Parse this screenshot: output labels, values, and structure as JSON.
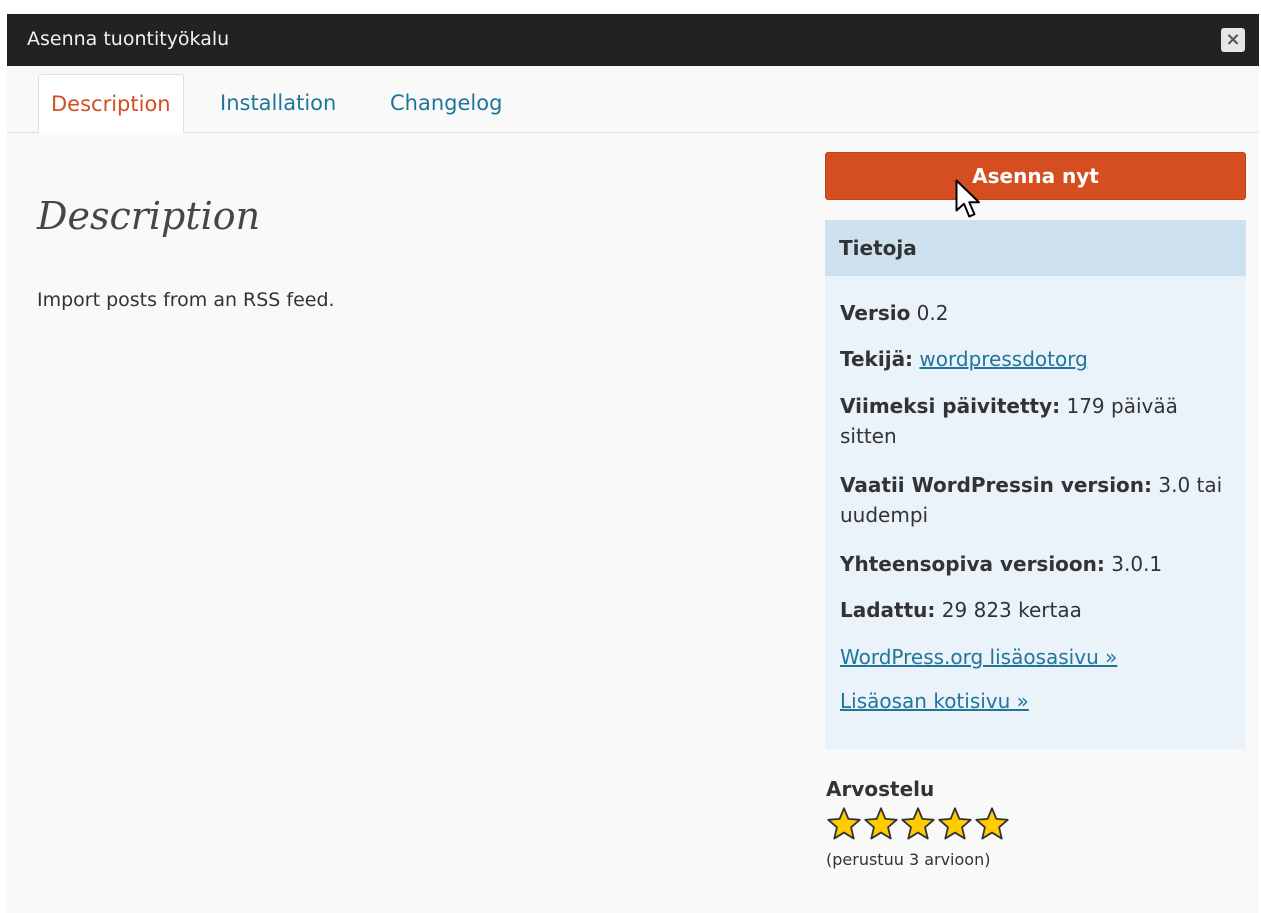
{
  "dialog": {
    "title": "Asenna tuontityökalu",
    "close_symbol": "×",
    "close_icon": "close-icon"
  },
  "tabs": [
    {
      "label": "Description",
      "active": true
    },
    {
      "label": "Installation",
      "active": false
    },
    {
      "label": "Changelog",
      "active": false
    }
  ],
  "main": {
    "heading": "Description",
    "text": "Import posts from an RSS feed."
  },
  "sidebar": {
    "install_button": "Asenna nyt",
    "info_heading": "Tietoja",
    "version_label": "Versio",
    "version_value": "0.2",
    "author_label": "Tekijä:",
    "author_link": "wordpressdotorg",
    "updated_label": "Viimeksi päivitetty:",
    "updated_value": "179 päivää sitten",
    "requires_label": "Vaatii WordPressin version:",
    "requires_value": "3.0 tai uudempi",
    "compatible_label": "Yhteensopiva versioon:",
    "compatible_value": "3.0.1",
    "downloaded_label": "Ladattu:",
    "downloaded_value": "29 823 kertaa",
    "plugin_page_link": "WordPress.org lisäosasivu »",
    "homepage_link": "Lisäosan kotisivu »"
  },
  "rating": {
    "label": "Arvostelu",
    "stars": 5,
    "max_stars": 5,
    "note": "(perustuu 3 arvioon)"
  },
  "colors": {
    "accent": "#d54e21",
    "link": "#21759b",
    "titlebar": "#222222",
    "info_bg": "#eaf2fa",
    "info_head_bg": "#cee1ef",
    "star": "#ffcc00"
  }
}
